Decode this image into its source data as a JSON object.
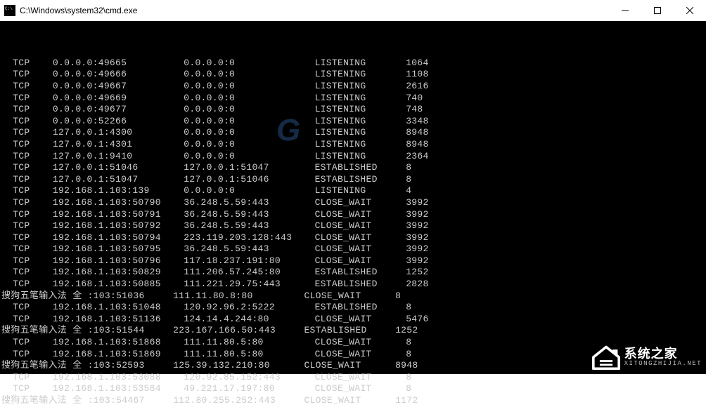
{
  "window": {
    "title": "C:\\Windows\\system32\\cmd.exe"
  },
  "overlay": {
    "center_text": "G",
    "brand_cn": "系统之家",
    "brand_en": "XITONGZHIJIA.NET"
  },
  "rows": [
    {
      "proto": "TCP",
      "local": "0.0.0.0:49665",
      "remote": "0.0.0.0:0",
      "state": "LISTENING",
      "pid": "1064"
    },
    {
      "proto": "TCP",
      "local": "0.0.0.0:49666",
      "remote": "0.0.0.0:0",
      "state": "LISTENING",
      "pid": "1108"
    },
    {
      "proto": "TCP",
      "local": "0.0.0.0:49667",
      "remote": "0.0.0.0:0",
      "state": "LISTENING",
      "pid": "2616"
    },
    {
      "proto": "TCP",
      "local": "0.0.0.0:49669",
      "remote": "0.0.0.0:0",
      "state": "LISTENING",
      "pid": "740"
    },
    {
      "proto": "TCP",
      "local": "0.0.0.0:49677",
      "remote": "0.0.0.0:0",
      "state": "LISTENING",
      "pid": "748"
    },
    {
      "proto": "TCP",
      "local": "0.0.0.0:52266",
      "remote": "0.0.0.0:0",
      "state": "LISTENING",
      "pid": "3348"
    },
    {
      "proto": "TCP",
      "local": "127.0.0.1:4300",
      "remote": "0.0.0.0:0",
      "state": "LISTENING",
      "pid": "8948"
    },
    {
      "proto": "TCP",
      "local": "127.0.0.1:4301",
      "remote": "0.0.0.0:0",
      "state": "LISTENING",
      "pid": "8948"
    },
    {
      "proto": "TCP",
      "local": "127.0.0.1:9410",
      "remote": "0.0.0.0:0",
      "state": "LISTENING",
      "pid": "2364"
    },
    {
      "proto": "TCP",
      "local": "127.0.0.1:51046",
      "remote": "127.0.0.1:51047",
      "state": "ESTABLISHED",
      "pid": "8"
    },
    {
      "proto": "TCP",
      "local": "127.0.0.1:51047",
      "remote": "127.0.0.1:51046",
      "state": "ESTABLISHED",
      "pid": "8"
    },
    {
      "proto": "TCP",
      "local": "192.168.1.103:139",
      "remote": "0.0.0.0:0",
      "state": "LISTENING",
      "pid": "4"
    },
    {
      "proto": "TCP",
      "local": "192.168.1.103:50790",
      "remote": "36.248.5.59:443",
      "state": "CLOSE_WAIT",
      "pid": "3992"
    },
    {
      "proto": "TCP",
      "local": "192.168.1.103:50791",
      "remote": "36.248.5.59:443",
      "state": "CLOSE_WAIT",
      "pid": "3992"
    },
    {
      "proto": "TCP",
      "local": "192.168.1.103:50792",
      "remote": "36.248.5.59:443",
      "state": "CLOSE_WAIT",
      "pid": "3992"
    },
    {
      "proto": "TCP",
      "local": "192.168.1.103:50794",
      "remote": "223.119.203.128:443",
      "state": "CLOSE_WAIT",
      "pid": "3992"
    },
    {
      "proto": "TCP",
      "local": "192.168.1.103:50795",
      "remote": "36.248.5.59:443",
      "state": "CLOSE_WAIT",
      "pid": "3992"
    },
    {
      "proto": "TCP",
      "local": "192.168.1.103:50796",
      "remote": "117.18.237.191:80",
      "state": "CLOSE_WAIT",
      "pid": "3992"
    },
    {
      "proto": "TCP",
      "local": "192.168.1.103:50829",
      "remote": "111.206.57.245:80",
      "state": "ESTABLISHED",
      "pid": "1252"
    },
    {
      "proto": "TCP",
      "local": "192.168.1.103:50885",
      "remote": "111.221.29.75:443",
      "state": "ESTABLISHED",
      "pid": "2828"
    },
    {
      "raw": "搜狗五笔输入法 全 :103:51036     111.11.80.8:80         CLOSE_WAIT      8"
    },
    {
      "proto": "TCP",
      "local": "192.168.1.103:51048",
      "remote": "120.92.96.2:5222",
      "state": "ESTABLISHED",
      "pid": "8"
    },
    {
      "proto": "TCP",
      "local": "192.168.1.103:51136",
      "remote": "124.14.4.244:80",
      "state": "CLOSE_WAIT",
      "pid": "5476"
    },
    {
      "raw": "搜狗五笔输入法 全 :103:51544     223.167.166.50:443     ESTABLISHED     1252"
    },
    {
      "proto": "TCP",
      "local": "192.168.1.103:51868",
      "remote": "111.11.80.5:80",
      "state": "CLOSE_WAIT",
      "pid": "8"
    },
    {
      "proto": "TCP",
      "local": "192.168.1.103:51869",
      "remote": "111.11.80.5:80",
      "state": "CLOSE_WAIT",
      "pid": "8"
    },
    {
      "raw": "搜狗五笔输入法 全 :103:52593     125.39.132.210:80      CLOSE_WAIT      8948"
    },
    {
      "proto": "TCP",
      "local": "192.168.1.103:53088",
      "remote": "120.92.85.152:443",
      "state": "CLOSE_WAIT",
      "pid": "8"
    },
    {
      "proto": "TCP",
      "local": "192.168.1.103:53584",
      "remote": "49.221.17.197:80",
      "state": "CLOSE_WAIT",
      "pid": "8"
    },
    {
      "raw": "搜狗五笔输入法 全 :103:54467     112.80.255.252:443     CLOSE_WAIT      1172"
    }
  ]
}
